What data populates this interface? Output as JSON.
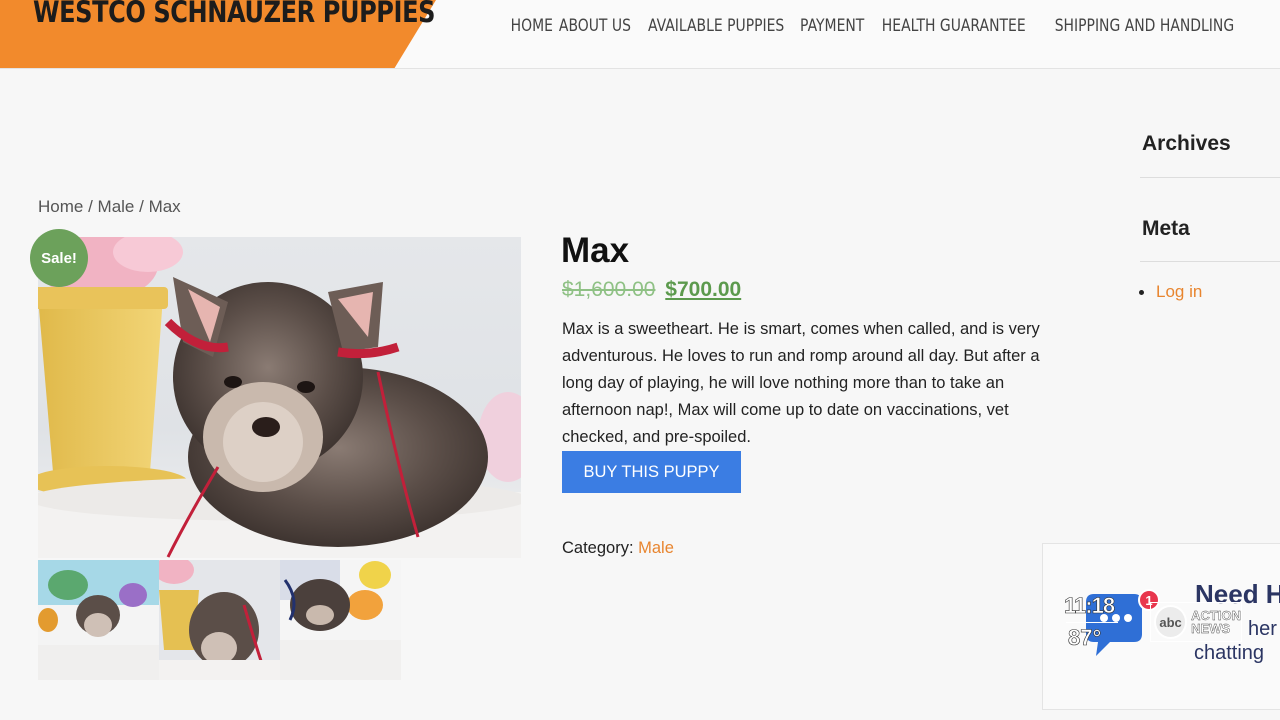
{
  "header": {
    "logo_text": "WESTCO SCHNAUZER PUPPIES",
    "nav": [
      "HOME",
      "ABOUT US",
      "AVAILABLE PUPPIES",
      "PAYMENT",
      "HEALTH GUARANTEE",
      "SHIPPING AND HANDLING"
    ]
  },
  "breadcrumb": {
    "home": "Home",
    "sep1": " / ",
    "category": "Male",
    "sep2": " / ",
    "current": "Max"
  },
  "product": {
    "sale_badge": "Sale!",
    "title": "Max",
    "price_old": "$1,600.00",
    "price_new": "$700.00",
    "description": "Max is a sweetheart. He is smart, comes when called, and is very adventurous. He loves to run and romp around all day. But after a long day of playing, he will love nothing more than to take an afternoon nap!, Max will come up to date on vaccinations, vet checked, and pre-spoiled.",
    "buy_label": "BUY THIS PUPPY",
    "category_label": "Category: ",
    "category_value": "Male"
  },
  "sidebar": {
    "archives_title": "Archives",
    "meta_title": "Meta",
    "meta_links": [
      "Log in"
    ]
  },
  "chat": {
    "title": "Need H",
    "line1": "her",
    "line2": "chatting",
    "badge": "1"
  },
  "tv_overlay": {
    "time": "11:18",
    "temp": "87°",
    "network": "abc",
    "brand_line1": "ACTION",
    "brand_line2": "NEWS"
  },
  "colors": {
    "brand_orange": "#f28a2c",
    "sale_green": "#6ca15b",
    "price_green": "#5c9a4d",
    "button_blue": "#3b7de3",
    "link_orange": "#e8852f"
  }
}
